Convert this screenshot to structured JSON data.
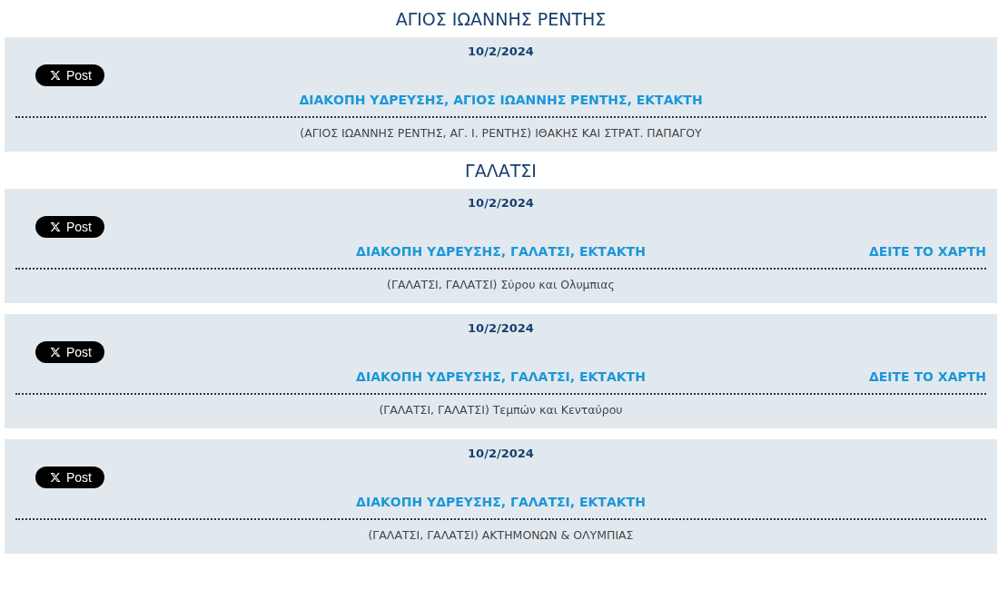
{
  "sections": [
    {
      "heading": "ΑΓΙΟΣ ΙΩΑΝΝΗΣ ΡΕΝΤΗΣ",
      "items": [
        {
          "date": "10/2/2024",
          "share_button": "Post",
          "title": "ΔΙΑΚΟΠΗ ΥΔΡΕΥΣΗΣ, ΑΓΙΟΣ ΙΩΑΝΝΗΣ ΡΕΝΤΗΣ, ΕΚΤΑΚΤΗ",
          "description": "(ΑΓΙΟΣ ΙΩΑΝΝΗΣ ΡΕΝΤΗΣ, ΑΓ. Ι. ΡΕΝΤΗΣ) ΙΘΑΚΗΣ ΚΑΙ ΣΤΡΑΤ. ΠΑΠΑΓΟΥ"
        }
      ]
    },
    {
      "heading": "ΓΑΛΑΤΣΙ",
      "items": [
        {
          "date": "10/2/2024",
          "share_button": "Post",
          "title": "ΔΙΑΚΟΠΗ ΥΔΡΕΥΣΗΣ, ΓΑΛΑΤΣΙ, ΕΚΤΑΚΤΗ",
          "map_link": "ΔΕΙΤΕ ΤΟ ΧΑΡΤΗ",
          "description": "(ΓΑΛΑΤΣΙ, ΓΑΛΑΤΣΙ) Σύρου και Ολυμπιας"
        },
        {
          "date": "10/2/2024",
          "share_button": "Post",
          "title": "ΔΙΑΚΟΠΗ ΥΔΡΕΥΣΗΣ, ΓΑΛΑΤΣΙ, ΕΚΤΑΚΤΗ",
          "map_link": "ΔΕΙΤΕ ΤΟ ΧΑΡΤΗ",
          "description": "(ΓΑΛΑΤΣΙ, ΓΑΛΑΤΣΙ) Τεμπών και Κενταύρου"
        },
        {
          "date": "10/2/2024",
          "share_button": "Post",
          "title": "ΔΙΑΚΟΠΗ ΥΔΡΕΥΣΗΣ, ΓΑΛΑΤΣΙ, ΕΚΤΑΚΤΗ",
          "description": "(ΓΑΛΑΤΣΙ, ΓΑΛΑΤΣΙ) ΑΚΤΗΜΟΝΩΝ & ΟΛΥΜΠΙΑΣ"
        }
      ]
    }
  ]
}
